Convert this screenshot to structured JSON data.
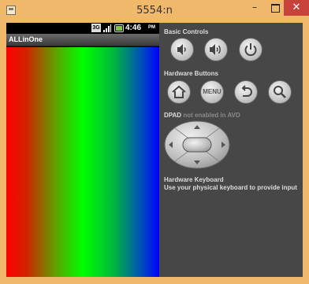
{
  "window": {
    "title": "5554:n",
    "controls": {
      "minimize": "–",
      "maximize": "",
      "close": "✕"
    }
  },
  "device": {
    "status_bar": {
      "network": "3G",
      "time": "4:46",
      "ampm": "PM"
    },
    "app_title": "ALLinOne",
    "content": "rgb-gradient"
  },
  "panel": {
    "basic_controls": {
      "heading": "Basic Controls",
      "buttons": [
        {
          "name": "volume-down",
          "icon": "volume-down-icon"
        },
        {
          "name": "volume-up",
          "icon": "volume-up-icon"
        },
        {
          "name": "power",
          "icon": "power-icon"
        }
      ]
    },
    "hardware_buttons": {
      "heading": "Hardware Buttons",
      "buttons": [
        {
          "name": "home",
          "icon": "home-icon"
        },
        {
          "name": "menu",
          "label": "MENU"
        },
        {
          "name": "back",
          "icon": "back-icon"
        },
        {
          "name": "search",
          "icon": "search-icon"
        }
      ]
    },
    "dpad": {
      "heading": "DPAD",
      "note": "not enabled in AVD"
    },
    "keyboard": {
      "heading": "Hardware Keyboard",
      "note": "Use your physical keyboard to provide input"
    }
  },
  "colors": {
    "frame": "#f0b86a",
    "close": "#c7423a",
    "panel": "#474747",
    "gradient": [
      "#ff0000",
      "#00ff00",
      "#0000ff"
    ]
  }
}
